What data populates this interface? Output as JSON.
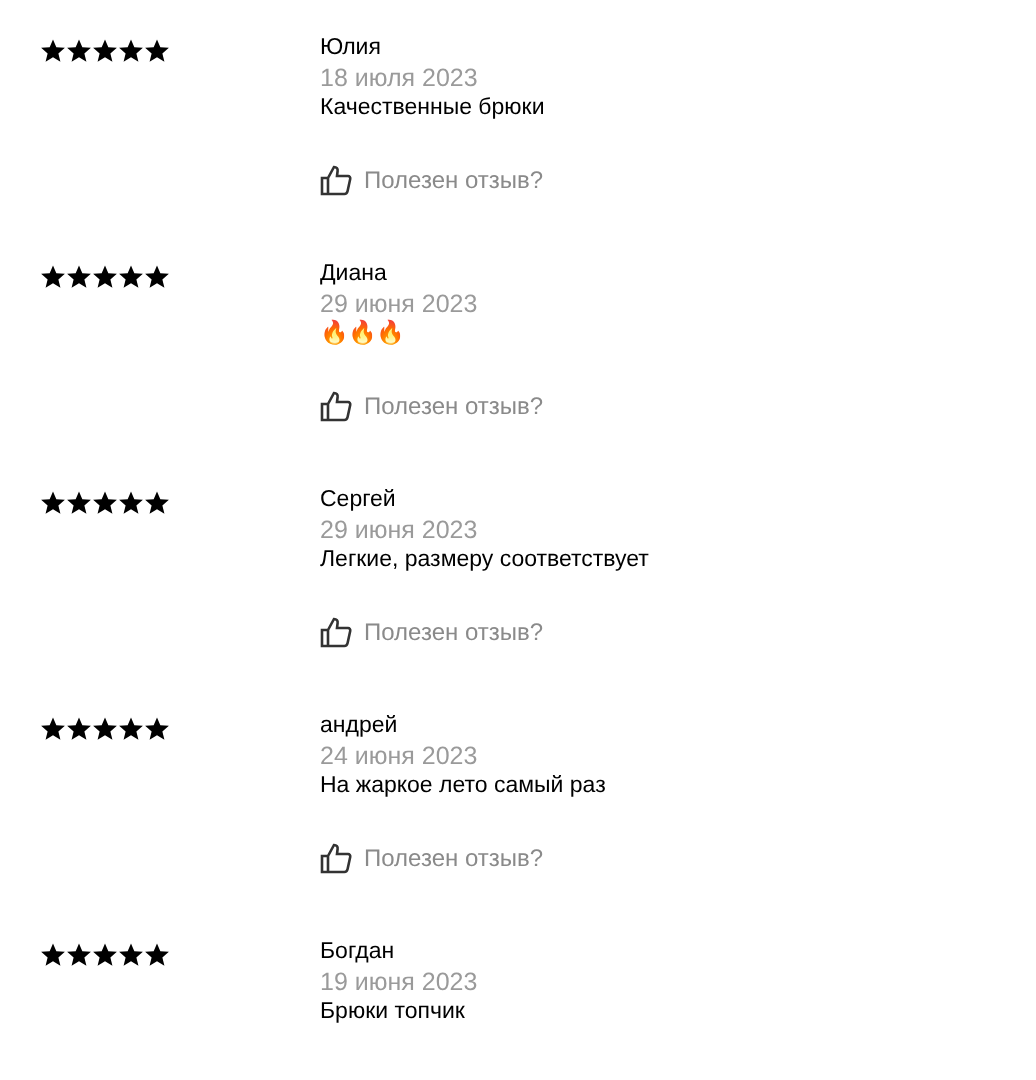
{
  "reviews": [
    {
      "stars": 5,
      "author": "Юлия",
      "date": "18 июля 2023",
      "text": "Качественные брюки",
      "helpful": "Полезен отзыв?"
    },
    {
      "stars": 5,
      "author": "Диана",
      "date": "29 июня 2023",
      "text": "🔥🔥🔥",
      "helpful": "Полезен отзыв?"
    },
    {
      "stars": 5,
      "author": "Сергей",
      "date": "29 июня 2023",
      "text": "Легкие, размеру соответствует",
      "helpful": "Полезен отзыв?"
    },
    {
      "stars": 5,
      "author": "андрей",
      "date": "24 июня 2023",
      "text": "На жаркое лето самый раз",
      "helpful": "Полезен отзыв?"
    },
    {
      "stars": 5,
      "author": "Богдан",
      "date": "19 июня 2023",
      "text": "Брюки топчик"
    }
  ]
}
